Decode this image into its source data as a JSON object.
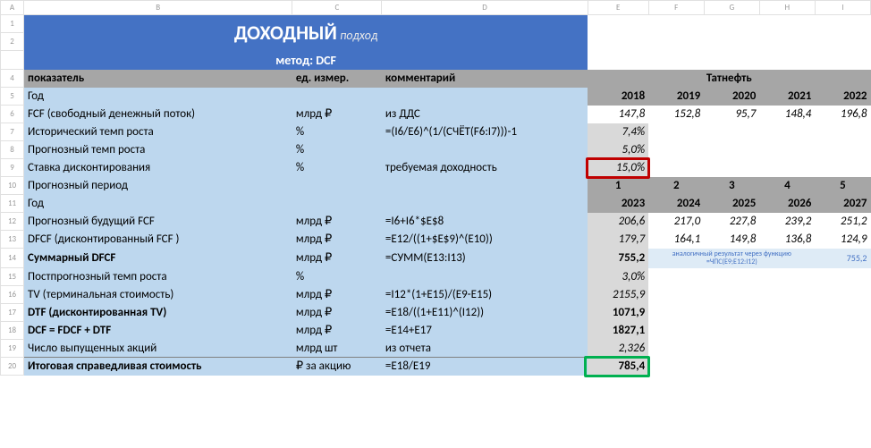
{
  "cols": {
    "A": "A",
    "B": "B",
    "C": "C",
    "D": "D",
    "E": "E",
    "F": "F",
    "G": "G",
    "H": "H",
    "I": "I"
  },
  "rownums": {
    "1": "1",
    "2": "2",
    "4": "4",
    "5": "5",
    "6": "6",
    "7": "7",
    "8": "8",
    "9": "9",
    "10": "10",
    "11": "11",
    "12": "12",
    "13": "13",
    "14": "14",
    "15": "15",
    "16": "16",
    "17": "17",
    "18": "18",
    "19": "19",
    "20": "20"
  },
  "title": {
    "main_bold": "ДОХОДНЫЙ",
    "main_light": " подход",
    "method_label": "метод: ",
    "method_val": "DCF"
  },
  "head": {
    "b": "показатель",
    "c": "ед. измер.",
    "d": "комментарий",
    "company": "Татнефть"
  },
  "r5": {
    "b": "Год",
    "e": "2018",
    "f": "2019",
    "g": "2020",
    "h": "2021",
    "i": "2022"
  },
  "r6": {
    "b": "FCF (свободный денежный поток)",
    "c": "млрд  ₽",
    "d": "из ДДС",
    "e": "147,8",
    "f": "152,8",
    "g": "95,7",
    "h": "148,4",
    "i": "196,8"
  },
  "r7": {
    "b": "Исторический темп роста",
    "c": "%",
    "d": "=(I6/E6)^(1/(СЧЁТ(F6:I7)))-1",
    "e": "7,4%"
  },
  "r8": {
    "b": "Прогнозный темп роста",
    "c": "%",
    "e": "5,0%"
  },
  "r9": {
    "b": "Ставка дисконтирования",
    "c": "%",
    "d": "требуемая доходность",
    "e": "15,0%"
  },
  "r10": {
    "b": "Прогнозный период",
    "e": "1",
    "f": "2",
    "g": "3",
    "h": "4",
    "i": "5"
  },
  "r11": {
    "b": "Год",
    "e": "2023",
    "f": "2024",
    "g": "2025",
    "h": "2026",
    "i": "2027"
  },
  "r12": {
    "b": "Прогнозный будущий FCF",
    "c": "млрд  ₽",
    "d": "=I6+I6*$E$8",
    "e": "206,6",
    "f": "217,0",
    "g": "227,8",
    "h": "239,2",
    "i": "251,2"
  },
  "r13": {
    "b": "DFCF (дисконтированный FCF )",
    "c": "млрд  ₽",
    "d": "=E12/((1+$E$9)^(E10))",
    "e": "179,7",
    "f": "164,1",
    "g": "149,8",
    "h": "136,8",
    "i": "124,9"
  },
  "r14": {
    "b": "Суммарный DFCF",
    "c": "млрд  ₽",
    "d": "=СУММ(E13:I13)",
    "e": "755,2",
    "note1": "аналогичный результат через функцию",
    "note2": "=ЧПС(E9;E12:I12)",
    "i": "755,2"
  },
  "r15": {
    "b": "Постпрогнозный темп роста",
    "c": "%",
    "e": "3,0%"
  },
  "r16": {
    "b": "TV (терминальная стоимость)",
    "c": "млрд  ₽",
    "d": "=I12*(1+E15)/(E9-E15)",
    "e": "2155,9"
  },
  "r17": {
    "b": "DTF (дисконтированная TV)",
    "c": "млрд  ₽",
    "d": "=E18/((1+E11)^(I12))",
    "e": "1071,9"
  },
  "r18": {
    "b": "DCF = FDCF + DTF",
    "c": "млрд  ₽",
    "d": "=E14+E17",
    "e": "1827,1"
  },
  "r19": {
    "b": "Число выпущенных акций",
    "c": "млрд шт",
    "d": "из отчета",
    "e": "2,326"
  },
  "r20": {
    "b": "Итоговая справедливая стоимость",
    "c": "₽ за акцию",
    "d": "=E18/E19",
    "e": "785,4"
  }
}
